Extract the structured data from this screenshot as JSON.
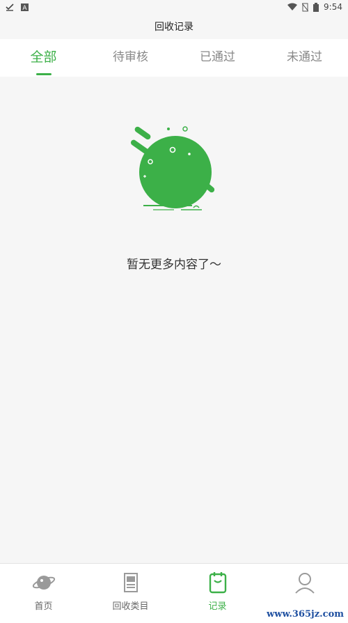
{
  "status_bar": {
    "time": "9:54",
    "left_icons": [
      "download-check-icon",
      "a-box-icon"
    ],
    "right_icons": [
      "wifi-icon",
      "battery-missing-icon",
      "battery-icon"
    ]
  },
  "header": {
    "title": "回收记录"
  },
  "tabs": [
    {
      "label": "全部",
      "active": true
    },
    {
      "label": "待审核",
      "active": false
    },
    {
      "label": "已通过",
      "active": false
    },
    {
      "label": "未通过",
      "active": false
    }
  ],
  "empty_state": {
    "message": "暂无更多内容了～",
    "illustration": "green-blob-icon"
  },
  "bottom_nav": [
    {
      "label": "首页",
      "icon": "planet-icon",
      "active": false
    },
    {
      "label": "回收类目",
      "icon": "box-icon",
      "active": false
    },
    {
      "label": "记录",
      "icon": "clipboard-icon",
      "active": true
    },
    {
      "label": "",
      "icon": "user-icon",
      "active": false
    }
  ],
  "watermark": "www.365jz.com",
  "colors": {
    "accent": "#3cb048",
    "background": "#f6f6f6",
    "tab_inactive": "#888888"
  }
}
